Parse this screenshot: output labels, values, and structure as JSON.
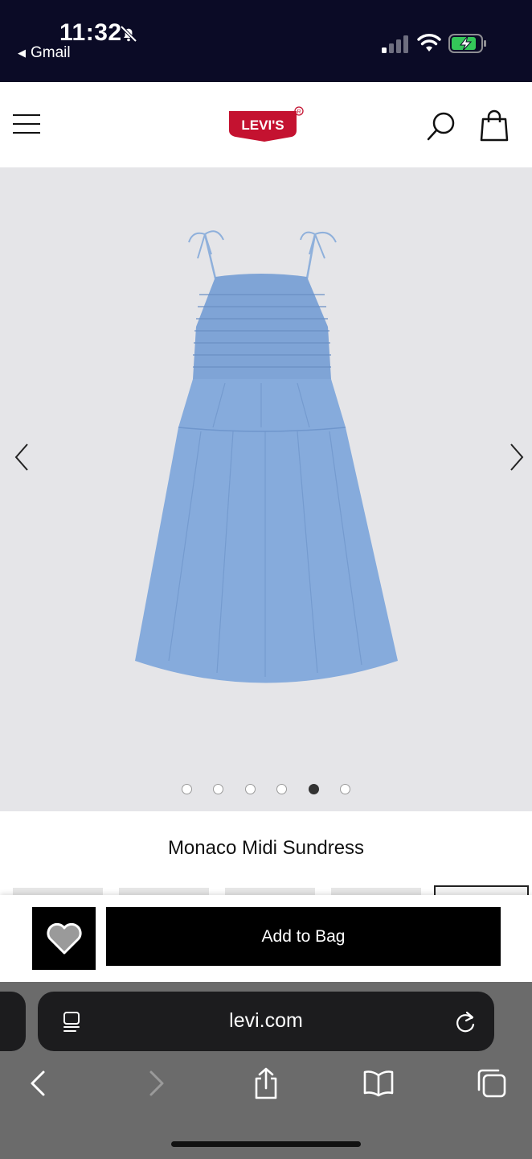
{
  "status_bar": {
    "time": "11:32",
    "back_app": "Gmail",
    "icons": [
      "bell-slash-icon",
      "cellular-signal-icon",
      "wifi-icon",
      "battery-charging-icon"
    ],
    "battery_color": "#34c759"
  },
  "header": {
    "logo_text": "LEVI'S",
    "logo_registered": "®",
    "brand_color": "#c41230",
    "icons": [
      "menu-icon",
      "search-icon",
      "shopping-bag-icon"
    ]
  },
  "gallery": {
    "background": "#e5e5e8",
    "dress_color": "#7fa4d6",
    "image_count": 6,
    "active_index": 4
  },
  "product": {
    "title": "Monaco Midi Sundress"
  },
  "cta": {
    "wishlist_icon": "heart-icon",
    "add_to_bag_label": "Add to Bag"
  },
  "browser": {
    "url": "levi.com",
    "toolbar": [
      "back-icon",
      "forward-icon",
      "share-icon",
      "bookmarks-icon",
      "tabs-icon"
    ]
  }
}
